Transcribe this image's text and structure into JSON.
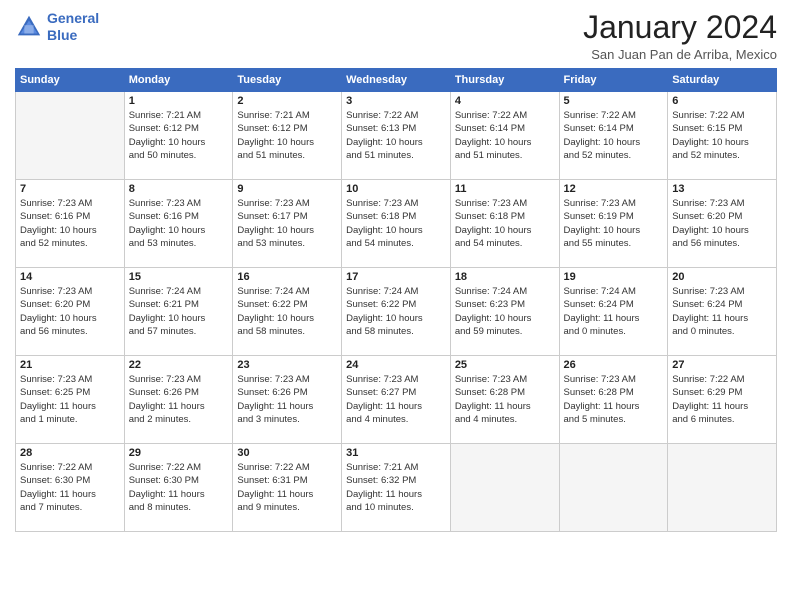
{
  "header": {
    "logo_line1": "General",
    "logo_line2": "Blue",
    "month_title": "January 2024",
    "location": "San Juan Pan de Arriba, Mexico"
  },
  "weekdays": [
    "Sunday",
    "Monday",
    "Tuesday",
    "Wednesday",
    "Thursday",
    "Friday",
    "Saturday"
  ],
  "weeks": [
    [
      {
        "num": "",
        "info": ""
      },
      {
        "num": "1",
        "info": "Sunrise: 7:21 AM\nSunset: 6:12 PM\nDaylight: 10 hours\nand 50 minutes."
      },
      {
        "num": "2",
        "info": "Sunrise: 7:21 AM\nSunset: 6:12 PM\nDaylight: 10 hours\nand 51 minutes."
      },
      {
        "num": "3",
        "info": "Sunrise: 7:22 AM\nSunset: 6:13 PM\nDaylight: 10 hours\nand 51 minutes."
      },
      {
        "num": "4",
        "info": "Sunrise: 7:22 AM\nSunset: 6:14 PM\nDaylight: 10 hours\nand 51 minutes."
      },
      {
        "num": "5",
        "info": "Sunrise: 7:22 AM\nSunset: 6:14 PM\nDaylight: 10 hours\nand 52 minutes."
      },
      {
        "num": "6",
        "info": "Sunrise: 7:22 AM\nSunset: 6:15 PM\nDaylight: 10 hours\nand 52 minutes."
      }
    ],
    [
      {
        "num": "7",
        "info": "Sunrise: 7:23 AM\nSunset: 6:16 PM\nDaylight: 10 hours\nand 52 minutes."
      },
      {
        "num": "8",
        "info": "Sunrise: 7:23 AM\nSunset: 6:16 PM\nDaylight: 10 hours\nand 53 minutes."
      },
      {
        "num": "9",
        "info": "Sunrise: 7:23 AM\nSunset: 6:17 PM\nDaylight: 10 hours\nand 53 minutes."
      },
      {
        "num": "10",
        "info": "Sunrise: 7:23 AM\nSunset: 6:18 PM\nDaylight: 10 hours\nand 54 minutes."
      },
      {
        "num": "11",
        "info": "Sunrise: 7:23 AM\nSunset: 6:18 PM\nDaylight: 10 hours\nand 54 minutes."
      },
      {
        "num": "12",
        "info": "Sunrise: 7:23 AM\nSunset: 6:19 PM\nDaylight: 10 hours\nand 55 minutes."
      },
      {
        "num": "13",
        "info": "Sunrise: 7:23 AM\nSunset: 6:20 PM\nDaylight: 10 hours\nand 56 minutes."
      }
    ],
    [
      {
        "num": "14",
        "info": "Sunrise: 7:23 AM\nSunset: 6:20 PM\nDaylight: 10 hours\nand 56 minutes."
      },
      {
        "num": "15",
        "info": "Sunrise: 7:24 AM\nSunset: 6:21 PM\nDaylight: 10 hours\nand 57 minutes."
      },
      {
        "num": "16",
        "info": "Sunrise: 7:24 AM\nSunset: 6:22 PM\nDaylight: 10 hours\nand 58 minutes."
      },
      {
        "num": "17",
        "info": "Sunrise: 7:24 AM\nSunset: 6:22 PM\nDaylight: 10 hours\nand 58 minutes."
      },
      {
        "num": "18",
        "info": "Sunrise: 7:24 AM\nSunset: 6:23 PM\nDaylight: 10 hours\nand 59 minutes."
      },
      {
        "num": "19",
        "info": "Sunrise: 7:24 AM\nSunset: 6:24 PM\nDaylight: 11 hours\nand 0 minutes."
      },
      {
        "num": "20",
        "info": "Sunrise: 7:23 AM\nSunset: 6:24 PM\nDaylight: 11 hours\nand 0 minutes."
      }
    ],
    [
      {
        "num": "21",
        "info": "Sunrise: 7:23 AM\nSunset: 6:25 PM\nDaylight: 11 hours\nand 1 minute."
      },
      {
        "num": "22",
        "info": "Sunrise: 7:23 AM\nSunset: 6:26 PM\nDaylight: 11 hours\nand 2 minutes."
      },
      {
        "num": "23",
        "info": "Sunrise: 7:23 AM\nSunset: 6:26 PM\nDaylight: 11 hours\nand 3 minutes."
      },
      {
        "num": "24",
        "info": "Sunrise: 7:23 AM\nSunset: 6:27 PM\nDaylight: 11 hours\nand 4 minutes."
      },
      {
        "num": "25",
        "info": "Sunrise: 7:23 AM\nSunset: 6:28 PM\nDaylight: 11 hours\nand 4 minutes."
      },
      {
        "num": "26",
        "info": "Sunrise: 7:23 AM\nSunset: 6:28 PM\nDaylight: 11 hours\nand 5 minutes."
      },
      {
        "num": "27",
        "info": "Sunrise: 7:22 AM\nSunset: 6:29 PM\nDaylight: 11 hours\nand 6 minutes."
      }
    ],
    [
      {
        "num": "28",
        "info": "Sunrise: 7:22 AM\nSunset: 6:30 PM\nDaylight: 11 hours\nand 7 minutes."
      },
      {
        "num": "29",
        "info": "Sunrise: 7:22 AM\nSunset: 6:30 PM\nDaylight: 11 hours\nand 8 minutes."
      },
      {
        "num": "30",
        "info": "Sunrise: 7:22 AM\nSunset: 6:31 PM\nDaylight: 11 hours\nand 9 minutes."
      },
      {
        "num": "31",
        "info": "Sunrise: 7:21 AM\nSunset: 6:32 PM\nDaylight: 11 hours\nand 10 minutes."
      },
      {
        "num": "",
        "info": ""
      },
      {
        "num": "",
        "info": ""
      },
      {
        "num": "",
        "info": ""
      }
    ]
  ]
}
